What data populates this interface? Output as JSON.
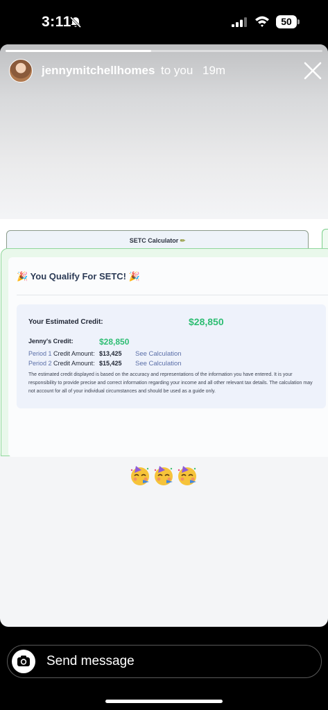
{
  "status_bar": {
    "time": "3:11",
    "battery": "50",
    "icons": [
      "bell-off-icon",
      "signal-icon",
      "wifi-icon",
      "battery-icon"
    ]
  },
  "story": {
    "progress": 0.46,
    "username": "jennymitchellhomes",
    "recipient": "to you",
    "time_ago": "19m",
    "icons": [
      "close-icon"
    ]
  },
  "calculator": {
    "tab_label": "SETC Calculator",
    "qualify_text": "You Qualify For SETC!",
    "estimated_label": "Your Estimated Credit:",
    "estimated_value": "$28,850",
    "jenny_label": "Jenny's Credit:",
    "jenny_value": "$28,850",
    "periods": [
      {
        "prefix": "Period 1",
        "label": "Credit Amount:",
        "amount": "$13,425",
        "link": "See Calculation"
      },
      {
        "prefix": "Period 2",
        "label": "Credit Amount:",
        "amount": "$15,425",
        "link": "See Calculation"
      }
    ],
    "disclaimer": "The estimated credit displayed is based on the accuracy and representations of the information you have entered. It is your responsibility to provide precise and correct information regarding your income and all other relevant tax details. The calculation may not account for all of your individual circumstances and should be used as a guide only."
  },
  "stickers": [
    "partying-face-emoji",
    "partying-face-emoji",
    "partying-face-emoji"
  ],
  "composer": {
    "placeholder": "Send message",
    "icons": [
      "camera-icon"
    ]
  },
  "colors": {
    "accent_green": "#2ebd73",
    "link_blue": "#5b6fa8",
    "border_green": "#8fd79b"
  }
}
